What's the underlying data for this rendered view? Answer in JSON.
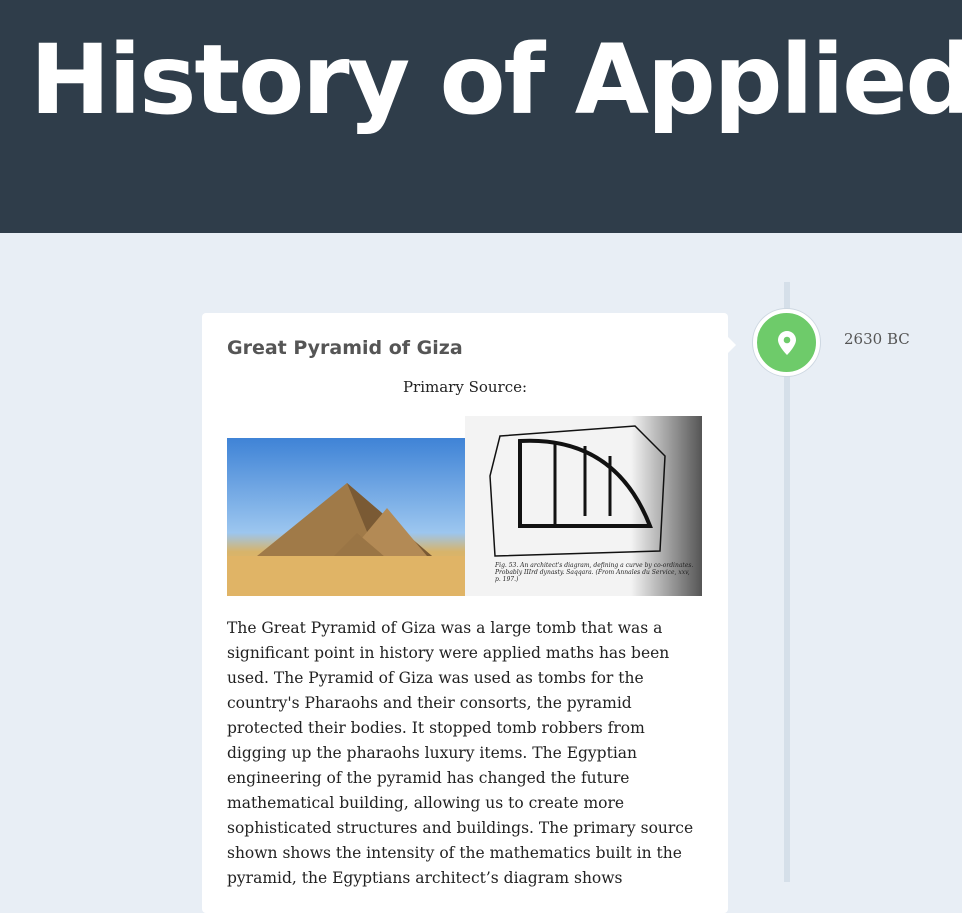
{
  "header": {
    "title": "History of Applied Maths"
  },
  "timeline": {
    "event": {
      "date": "2630 BC",
      "marker_icon": "map-pin-icon",
      "marker_color": "#6ecb6a",
      "title": "Great Pyramid of Giza",
      "source_label": "Primary Source:",
      "figure_caption": "Fig. 53. An architect's diagram, defining a curve by co-ordinates. Probably IIIrd dynasty. Saqqara. (From Annales du Service, xxv, p. 197.)",
      "body": "The Great Pyramid of Giza was a large tomb that was a significant point in history were applied maths has been used. The Pyramid of Giza was used as tombs for the country's Pharaohs and their consorts, the pyramid protected their bodies. It stopped tomb robbers from digging up the pharaohs luxury items. The Egyptian engineering of the pyramid has changed the future mathematical building, allowing us to create more sophisticated structures and buildings. The primary source shown shows the intensity of the mathematics built in the pyramid, the Egyptians architect’s diagram shows"
    }
  }
}
